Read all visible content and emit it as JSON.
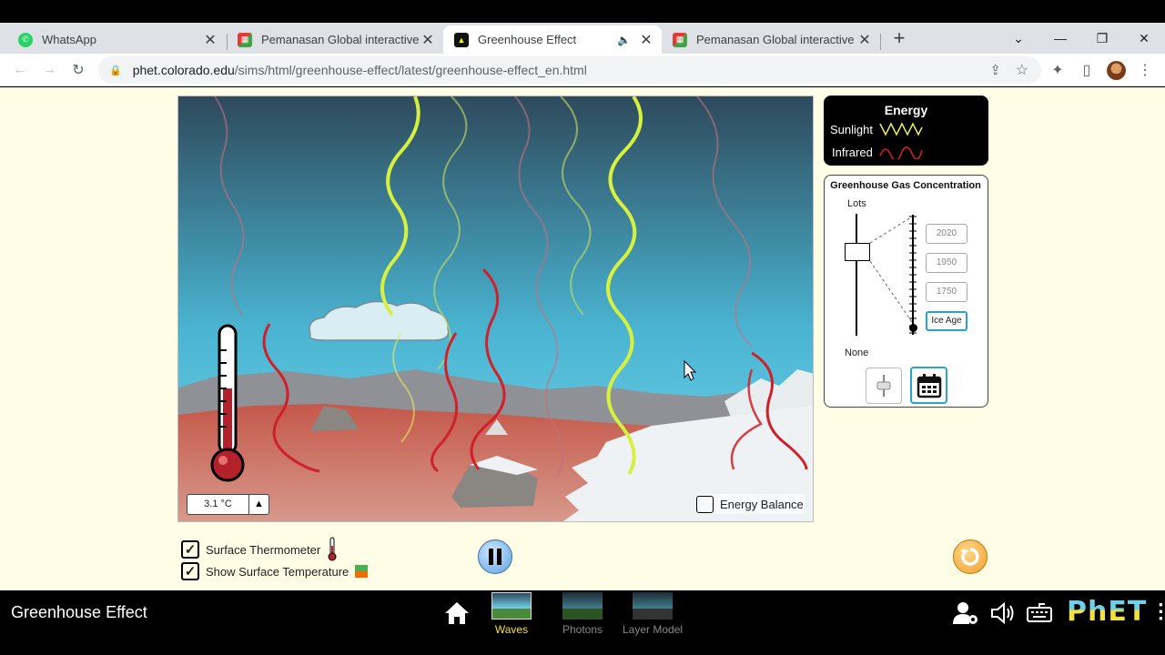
{
  "browser": {
    "tabs": [
      {
        "title": "WhatsApp",
        "icon": "whatsapp-icon",
        "active": false
      },
      {
        "title": "Pemanasan Global interactive exe",
        "icon": "liveworksheets-icon",
        "active": false
      },
      {
        "title": "Greenhouse Effect",
        "icon": "phet-icon",
        "active": true
      },
      {
        "title": "Pemanasan Global interactive exe",
        "icon": "liveworksheets-icon",
        "active": false
      }
    ],
    "url_host": "phet.colorado.edu",
    "url_path": "/sims/html/greenhouse-effect/latest/greenhouse-effect_en.html"
  },
  "legend": {
    "title": "Energy",
    "sunlight_label": "Sunlight",
    "infrared_label": "Infrared",
    "sunlight_color": "#f0f050",
    "infrared_color": "#d0202a"
  },
  "ggc": {
    "title": "Greenhouse Gas Concentration",
    "lots_label": "Lots",
    "none_label": "None",
    "eras": [
      "2020",
      "1950",
      "1750",
      "Ice Age"
    ],
    "selected_era": "Ice Age"
  },
  "sim": {
    "temperature_readout": "3.1 °C",
    "energy_balance_label": "Energy Balance",
    "energy_balance_checked": false
  },
  "controls": {
    "surface_thermometer_label": "Surface Thermometer",
    "surface_thermometer_checked": true,
    "show_surface_temp_label": "Show Surface Temperature",
    "show_surface_temp_checked": true
  },
  "navbar": {
    "sim_title": "Greenhouse Effect",
    "screens": [
      {
        "label": "Waves",
        "selected": true
      },
      {
        "label": "Photons",
        "selected": false
      },
      {
        "label": "Layer Model",
        "selected": false
      }
    ],
    "logo_text": "PhET"
  },
  "colors": {
    "sky_top": "#2e4a5c",
    "sky_bottom": "#6fd0e8",
    "ground": "#c56a5c",
    "accent_blue": "#2aa3c9",
    "reset_orange": "#f0a030",
    "page_bg": "#fffde6"
  }
}
